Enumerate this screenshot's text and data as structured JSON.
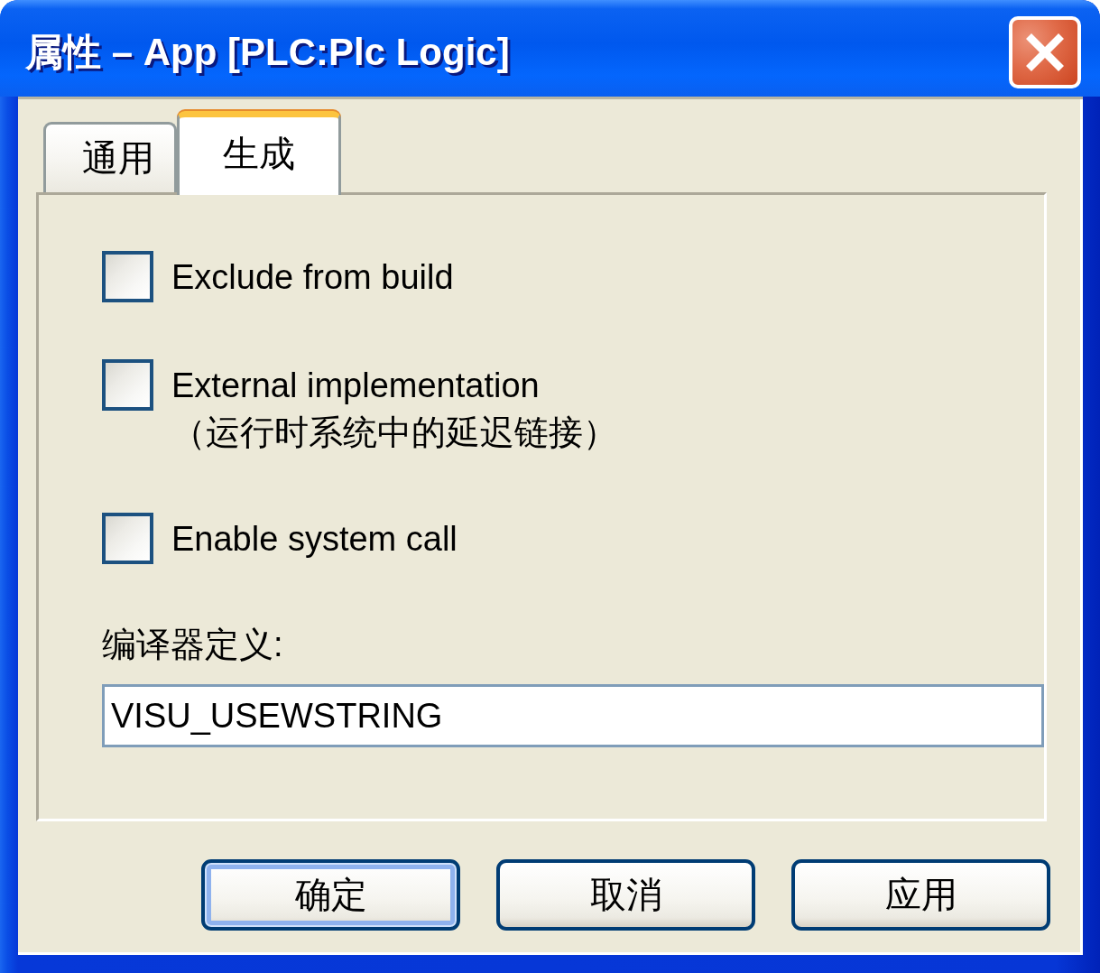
{
  "window": {
    "title": "属性 – App [PLC:Plc Logic]"
  },
  "tabs": [
    {
      "label": "通用",
      "selected": false
    },
    {
      "label": "生成",
      "selected": true
    }
  ],
  "options": [
    {
      "label": "Exclude from build",
      "checked": false
    },
    {
      "label": "External implementation\n（运行时系统中的延迟链接）",
      "checked": false
    },
    {
      "label": "Enable system call",
      "checked": false
    }
  ],
  "compiler_defines": {
    "label": "编译器定义:",
    "value": "VISU_USEWSTRING"
  },
  "buttons": [
    {
      "label": "确定",
      "default": true
    },
    {
      "label": "取消",
      "default": false
    },
    {
      "label": "应用",
      "default": false
    }
  ]
}
